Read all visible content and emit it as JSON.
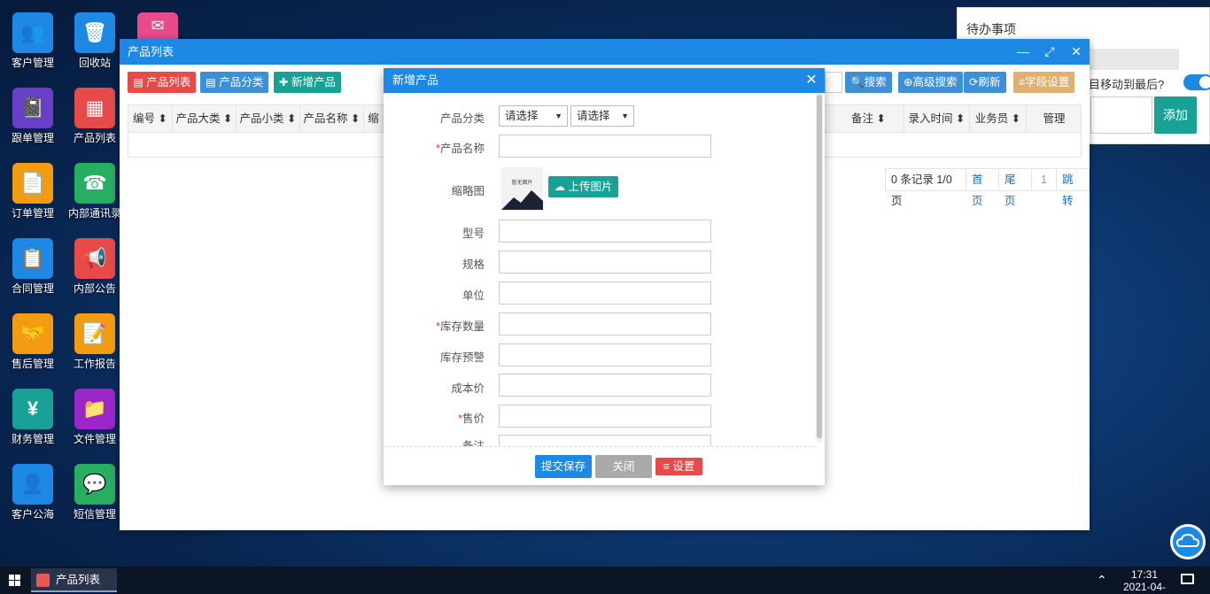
{
  "desktop": {
    "icons": [
      {
        "label": "客户管理",
        "color": "#1e88e5",
        "glyph": "👥"
      },
      {
        "label": "回收站",
        "color": "#1e88e5",
        "glyph": "🗑"
      },
      {
        "label": "跟单管理",
        "color": "#6a3fc8",
        "glyph": "📓"
      },
      {
        "label": "产品列表",
        "color": "#e84a4a",
        "glyph": "▦"
      },
      {
        "label": "订单管理",
        "color": "#f39c12",
        "glyph": "📄"
      },
      {
        "label": "内部通讯录",
        "color": "#27ae60",
        "glyph": "☎"
      },
      {
        "label": "合同管理",
        "color": "#1e88e5",
        "glyph": "📋"
      },
      {
        "label": "内部公告",
        "color": "#e84a4a",
        "glyph": "📢"
      },
      {
        "label": "售后管理",
        "color": "#f39c12",
        "glyph": "🤝"
      },
      {
        "label": "工作报告",
        "color": "#f39c12",
        "glyph": "📝"
      },
      {
        "label": "财务管理",
        "color": "#1aa195",
        "glyph": "¥"
      },
      {
        "label": "文件管理",
        "color": "#9b27c8",
        "glyph": "📁"
      },
      {
        "label": "客户公海",
        "color": "#1e88e5",
        "glyph": "👤"
      },
      {
        "label": "短信管理",
        "color": "#27ae60",
        "glyph": "💬"
      }
    ],
    "mail_icon_color": "#e84a8a"
  },
  "todo": {
    "title": "待办事项",
    "move_text": "目移动到最后?",
    "add_label": "添加"
  },
  "window": {
    "title": "产品列表",
    "controls": {
      "minimize": "—",
      "maximize": "⤢",
      "close": "✕"
    },
    "toolbar": {
      "product_list": "产品列表",
      "product_category": "产品分类",
      "add_product": "新增产品",
      "search": "搜索",
      "advanced_search": "高级搜索",
      "refresh": "刷新",
      "field_settings": "字段设置"
    },
    "columns": [
      "编号",
      "产品大类",
      "产品小类",
      "产品名称",
      "缩",
      "备注",
      "录入时间",
      "业务员",
      "管理"
    ],
    "pager": {
      "summary": "0 条记录 1/0页",
      "first": "首页",
      "last": "尾页",
      "current": "1",
      "jump": "跳转"
    }
  },
  "modal": {
    "title": "新增产品",
    "close": "✕",
    "fields": {
      "category": "产品分类",
      "select1": "请选择",
      "select2": "请选择",
      "name": "产品名称",
      "thumb": "缩略图",
      "thumb_placeholder": "暂无图片",
      "upload": "上传图片",
      "model": "型号",
      "spec": "规格",
      "unit": "单位",
      "stock": "库存数量",
      "stock_warn": "库存预警",
      "cost": "成本价",
      "price": "售价",
      "remark": "备注"
    },
    "buttons": {
      "submit": "提交保存",
      "close": "关闭",
      "settings": "设置"
    }
  },
  "taskbar": {
    "item": "产品列表",
    "time": "17:31",
    "date": "2021-04-"
  }
}
